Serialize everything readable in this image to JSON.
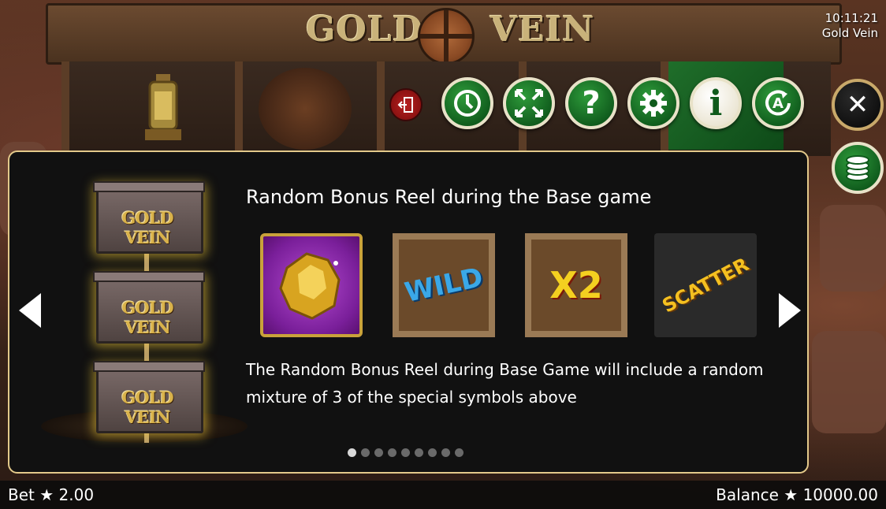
{
  "header": {
    "logo_left": "GOLD",
    "logo_right": "VEIN",
    "clock_time": "10:11:21",
    "game_name": "Gold Vein"
  },
  "toolbar": {
    "icons": [
      "exit-icon",
      "history-icon",
      "fullscreen-icon",
      "help-icon",
      "settings-icon",
      "info-icon",
      "autoplay-icon"
    ],
    "help_glyph": "?",
    "info_glyph": "i",
    "autoplay_glyph": "A"
  },
  "side_buttons": {
    "close_glyph": "✕",
    "coins_icon": "coins-icon"
  },
  "info_panel": {
    "title": "Random Bonus Reel during the Base game",
    "description": "The Random Bonus Reel during Base Game will include a random mixture of 3 of the special symbols above",
    "cart_label": "GOLD VEIN",
    "symbols": [
      {
        "name": "gold-nugget-symbol",
        "label": ""
      },
      {
        "name": "wild-symbol",
        "label": "WILD"
      },
      {
        "name": "x2-symbol",
        "label": "X2"
      },
      {
        "name": "scatter-symbol",
        "label": "SCATTER"
      }
    ],
    "page_count": 9,
    "active_page": 1
  },
  "footer": {
    "bet_label": "Bet ★ 2.00",
    "balance_label": "Balance ★ 10000.00"
  },
  "colors": {
    "accent_green": "#0f5a1c",
    "panel_border": "#e3c98a",
    "gold": "#d9b24a"
  }
}
